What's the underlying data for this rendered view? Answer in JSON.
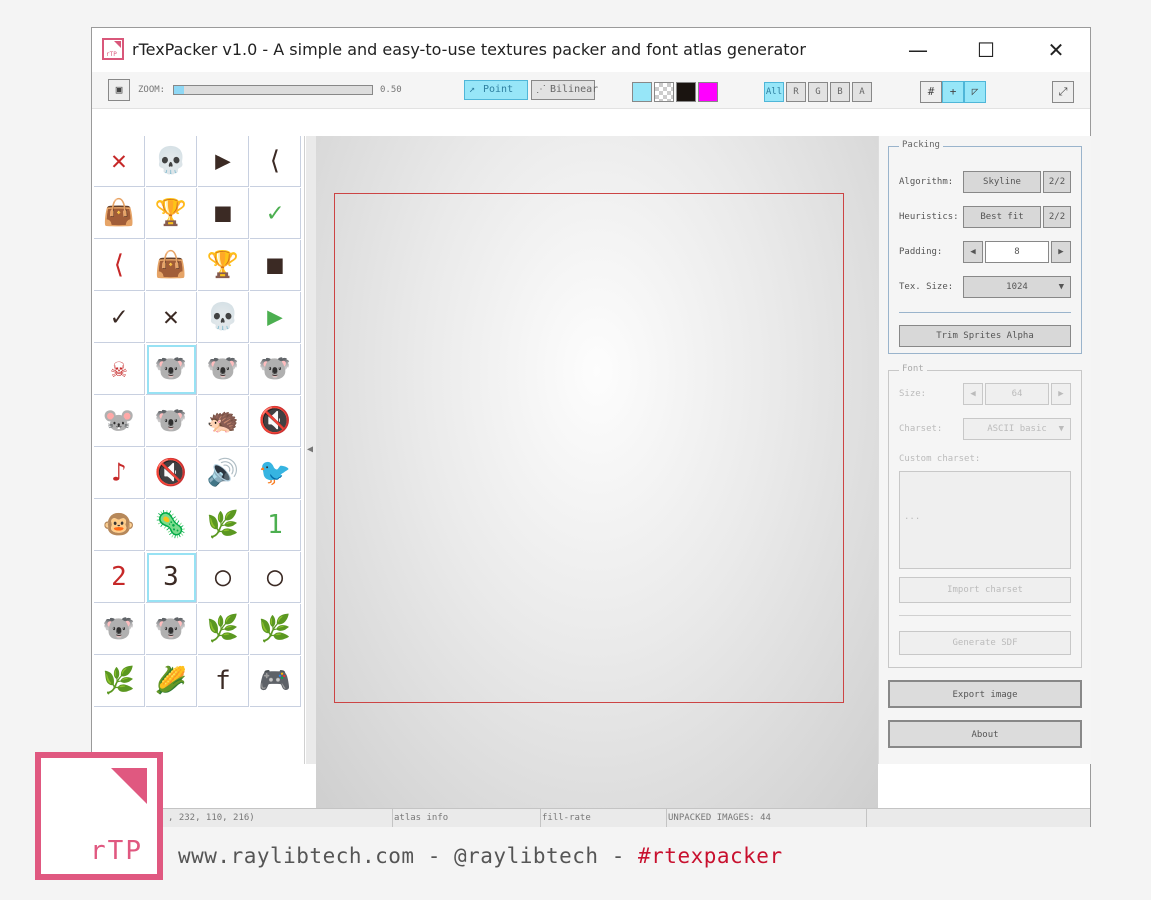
{
  "window": {
    "title": "rTexPacker v1.0 - A simple and easy-to-use textures packer and font atlas generator",
    "logo_text": "rTP",
    "minimize": "—",
    "maximize": "☐",
    "close": "✕"
  },
  "toolbar": {
    "zoom_label": "ZOOM:",
    "zoom_value": "0.50",
    "zoom_fraction": 0.05,
    "filter_point": "Point",
    "filter_bilinear": "Bilinear",
    "swatch_colors": [
      "#97e6f8",
      "checker",
      "#1a1410",
      "#ff00ff"
    ],
    "channels": [
      "All",
      "R",
      "G",
      "B",
      "A"
    ]
  },
  "packing": {
    "title": "Packing",
    "algorithm_label": "Algorithm:",
    "algorithm_value": "Skyline",
    "algorithm_index": "2/2",
    "heuristics_label": "Heuristics:",
    "heuristics_value": "Best fit",
    "heuristics_index": "2/2",
    "padding_label": "Padding:",
    "padding_value": "8",
    "texsize_label": "Tex. Size:",
    "texsize_value": "1024",
    "trim_button": "Trim Sprites Alpha"
  },
  "font": {
    "title": "Font",
    "size_label": "Size:",
    "size_value": "64",
    "charset_label": "Charset:",
    "charset_value": "ASCII basic",
    "custom_charset_label": "Custom charset:",
    "custom_charset_value": "...",
    "import_button": "Import charset",
    "sdf_button": "Generate SDF"
  },
  "actions": {
    "export_button": "Export image",
    "about_button": "About"
  },
  "status": {
    "selection": ", 232, 110, 216)",
    "atlas_info": "atlas info",
    "fill_rate": "fill-rate",
    "unpacked": "UNPACKED IMAGES: 44"
  },
  "footer": {
    "website": "www.raylibtech.com - @raylibtech - ",
    "hashtag": "#rtexpacker",
    "logo_text": "rTP"
  },
  "sprite_list": [
    "✕",
    "💀",
    "▶",
    "⟨",
    "👜",
    "🏆",
    "■",
    "✓",
    "⟨",
    "👜",
    "🏆",
    "■",
    "✓",
    "✕",
    "💀",
    "▶",
    "☠",
    "🐨",
    "🐨",
    "🐨",
    "🐭",
    "🐨",
    "🦔",
    "🔇",
    "♪",
    "🔇",
    "🔊",
    "🐦",
    "🐵",
    "🦠",
    "🌿",
    "1",
    "2",
    "3",
    "◯",
    "◯",
    "🐨",
    "🐨",
    "🌿",
    "🌿",
    "🌿",
    "🌽",
    "f",
    "🎮"
  ]
}
